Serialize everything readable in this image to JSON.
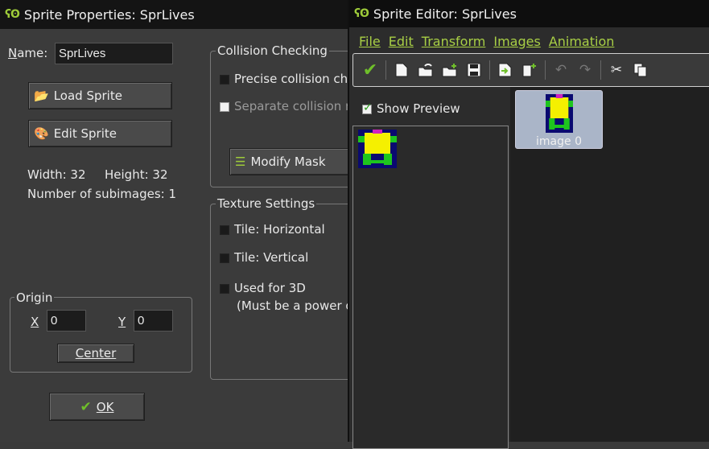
{
  "left": {
    "title": "Sprite Properties: SprLives",
    "name_label": "Name:",
    "name_value": "SprLives",
    "load_sprite": "Load Sprite",
    "edit_sprite": "Edit Sprite",
    "width_text": "Width: 32",
    "height_text": "Height: 32",
    "subimages_text": "Number of subimages: 1",
    "origin_legend": "Origin",
    "x_label": "X",
    "x_value": "0",
    "y_label": "Y",
    "y_value": "0",
    "center_btn": "Center",
    "ok_btn": "OK",
    "collision_legend": "Collision Checking",
    "precise_label": "Precise collision ch",
    "separate_label": "Separate collision m",
    "modify_mask": "Modify Mask",
    "texture_legend": "Texture Settings",
    "tile_h": "Tile: Horizontal",
    "tile_v": "Tile: Vertical",
    "used_3d": "Used for 3D",
    "power_note": "(Must be a power o"
  },
  "right": {
    "title": "Sprite Editor: SprLives",
    "menu": [
      "File",
      "Edit",
      "Transform",
      "Images",
      "Animation"
    ],
    "show_preview": "Show Preview",
    "image_label": "image 0"
  },
  "colors": {
    "menu_accent": "#a8cf45",
    "check_green": "#6fbf2a",
    "sprite_yellow": "#f5f000",
    "sprite_green": "#1ec51e",
    "sprite_navy": "#0a0a70",
    "sprite_magenta": "#d020c0"
  }
}
